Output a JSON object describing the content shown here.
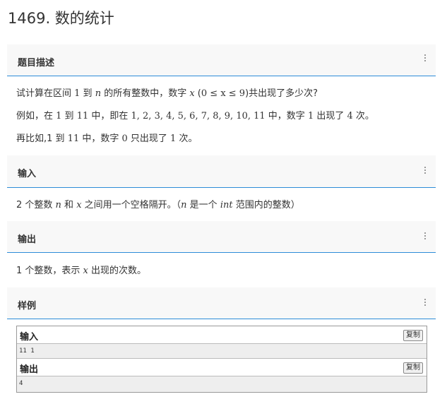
{
  "page": {
    "title": "1469. 数的统计"
  },
  "sections": {
    "description": {
      "title": "题目描述",
      "p1": {
        "a": "试计算在区间 ",
        "b": "1",
        "c": " 到 ",
        "d": "n",
        "e": " 的所有整数中，数字 ",
        "f": "x",
        "g": " (",
        "h": "0 ≤ x ≤ 9",
        "i": ")共出现了多少次?"
      },
      "p2": {
        "a": "例如，在 ",
        "b": "1",
        "c": " 到 ",
        "d": "11",
        "e": " 中，即在 ",
        "f": "1, 2, 3, 4, 5, 6, 7, 8, 9, 10, 11",
        "g": " 中，数字 ",
        "h": "1",
        "i": " 出现了 ",
        "j": "4",
        "k": " 次。"
      },
      "p3": {
        "a": "再比如,1 到 ",
        "b": "11",
        "c": " 中，数字 ",
        "d": "0",
        "e": " 只出现了 ",
        "f": "1",
        "g": " 次。"
      }
    },
    "input": {
      "title": "输入",
      "p1": {
        "a": "2 个整数 ",
        "b": "n",
        "c": " 和 ",
        "d": "x",
        "e": " 之间用一个空格隔开。（",
        "f": "n",
        "g": " 是一个 ",
        "h": "int",
        "i": " 范围内的整数）"
      }
    },
    "output": {
      "title": "输出",
      "p1": {
        "a": "1 个整数，表示 ",
        "b": "x",
        "c": " 出现的次数。"
      }
    },
    "sample": {
      "title": "样例",
      "input_label": "输入",
      "input_value": "11 1",
      "output_label": "输出",
      "output_value": "4",
      "copy_label": "复制"
    }
  },
  "icons": {
    "section_menu": "kebab-menu-icon"
  },
  "colors": {
    "accent_line": "#2d8cd8",
    "header_bg": "#f8f8f8",
    "sample_body_bg": "#eeeeee"
  }
}
